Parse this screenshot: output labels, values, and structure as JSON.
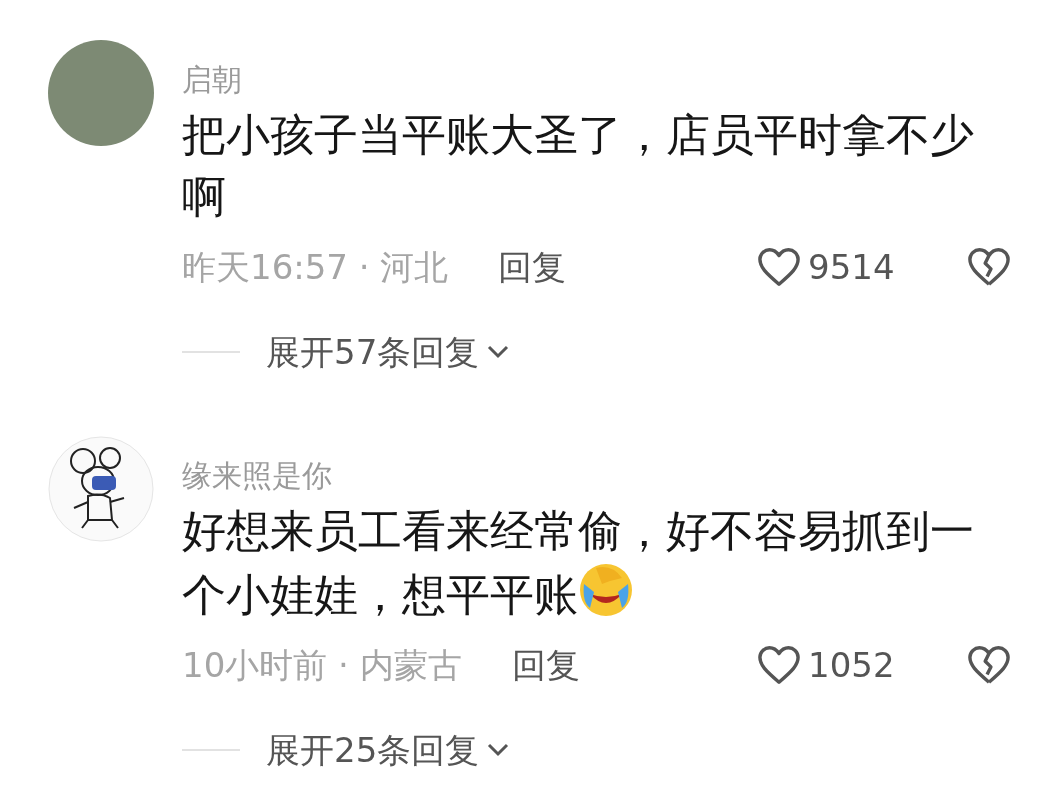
{
  "comments": [
    {
      "avatar": {
        "kind": "photo"
      },
      "username": "启朝",
      "text": "把小孩子当平账大圣了，店员平时拿不少啊",
      "emoji": false,
      "meta": "昨天16:57 · 河北",
      "reply": "回复",
      "likes": "9514",
      "expand": "展开57条回复"
    },
    {
      "avatar": {
        "kind": "drawing"
      },
      "username": "缘来照是你",
      "text": "好想来员工看来经常偷，好不容易抓到一个小娃娃，想平平账",
      "emoji": true,
      "meta": "10小时前 · 内蒙古",
      "reply": "回复",
      "likes": "1052",
      "expand": "展开25条回复"
    }
  ]
}
